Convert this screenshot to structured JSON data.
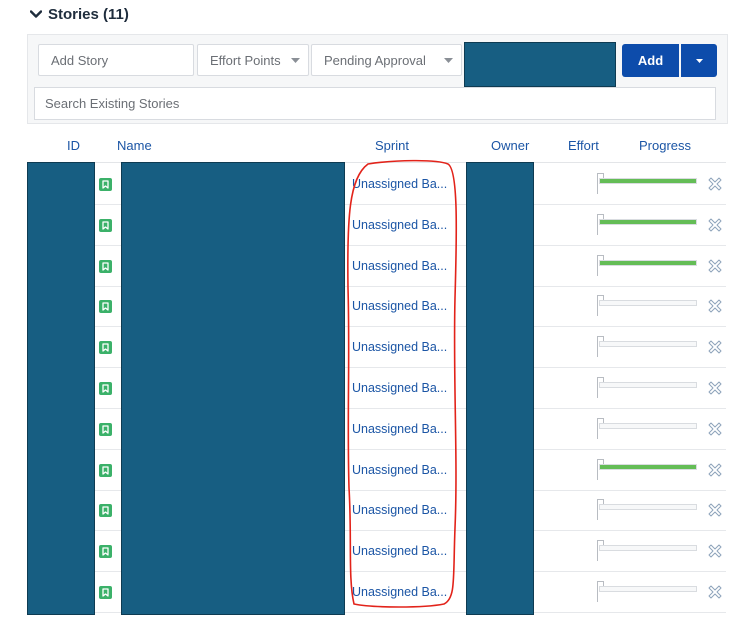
{
  "section": {
    "title": "Stories (11)"
  },
  "toolbar": {
    "add_story_placeholder": "Add Story",
    "effort_select": "Effort Points",
    "status_select": "Pending Approval",
    "add_label": "Add",
    "search_placeholder": "Search Existing Stories"
  },
  "columns": {
    "id": "ID",
    "name": "Name",
    "sprint": "Sprint",
    "owner": "Owner",
    "effort": "Effort",
    "progress": "Progress"
  },
  "rows": [
    {
      "sprint": "Unassigned Ba...",
      "progress": 1.0
    },
    {
      "sprint": "Unassigned Ba...",
      "progress": 1.0
    },
    {
      "sprint": "Unassigned Ba...",
      "progress": 1.0
    },
    {
      "sprint": "Unassigned Ba...",
      "progress": 0.0
    },
    {
      "sprint": "Unassigned Ba...",
      "progress": 0.0
    },
    {
      "sprint": "Unassigned Ba...",
      "progress": 0.0
    },
    {
      "sprint": "Unassigned Ba...",
      "progress": 0.0
    },
    {
      "sprint": "Unassigned Ba...",
      "progress": 1.0
    },
    {
      "sprint": "Unassigned Ba...",
      "progress": 0.0
    },
    {
      "sprint": "Unassigned Ba...",
      "progress": 0.0
    },
    {
      "sprint": "Unassigned Ba...",
      "progress": 0.0
    }
  ],
  "colors": {
    "accent": "#0d4cab",
    "link": "#1b55a5",
    "progress": "#64bd56",
    "story_icon": "#3bb169",
    "redaction": "#175e82",
    "annotation": "#e2231a"
  },
  "icons": {
    "section_toggle": "caret-down-icon",
    "row_type": "story-bookmark-icon",
    "row_action": "remove-x-icon"
  }
}
